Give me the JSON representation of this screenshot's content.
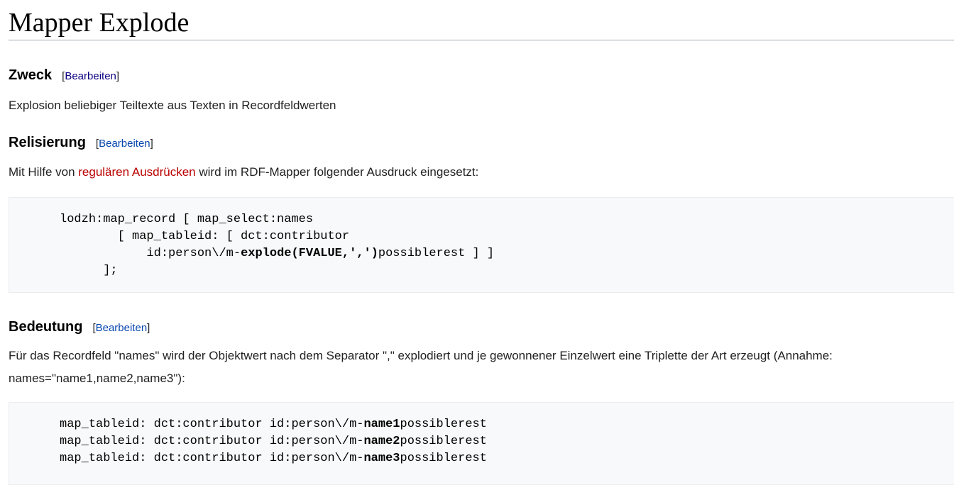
{
  "page": {
    "title": "Mapper Explode"
  },
  "sections": {
    "zweck": {
      "heading": "Zweck",
      "bracket_open": "[",
      "edit_label": "Bearbeiten",
      "bracket_close": "]",
      "text": "Explosion beliebiger Teiltexte aus Texten in Recordfeldwerten"
    },
    "relisierung": {
      "heading": "Relisierung",
      "bracket_open": "[",
      "edit_label": "Bearbeiten",
      "bracket_close": "]",
      "text_before": "Mit Hilfe von ",
      "link_text": "regulären Ausdrücken",
      "text_after": " wird im RDF-Mapper folgender Ausdruck eingesetzt:",
      "code": {
        "line1": "     lodzh:map_record [ map_select:names",
        "line2_indent": "             [ map_tableid: [ dct:contributor",
        "line3_pre": "                 id:person\\/m-",
        "line3_bold": "explode(FVALUE,',')",
        "line3_post": "possiblerest ] ]",
        "line4": "           ];"
      }
    },
    "bedeutung": {
      "heading": "Bedeutung",
      "bracket_open": "[",
      "edit_label": "Bearbeiten",
      "bracket_close": "]",
      "text": "Für das Recordfeld \"names\" wird der Objektwert nach dem Separator \",\" explodiert und je gewonnener Einzelwert eine Triplette der Art erzeugt (Annahme: names=\"name1,name2,name3\"):",
      "code": {
        "prefix": "     map_tableid: dct:contributor id:person\\/m-",
        "suffix": "possiblerest",
        "names": [
          "name1",
          "name2",
          "name3"
        ]
      }
    }
  },
  "colors": {
    "link": "#0645ad",
    "visited_link": "#0b0080",
    "red_link": "#ba0000",
    "code_background": "#f8f9fa",
    "rule": "#a2a9b1"
  }
}
